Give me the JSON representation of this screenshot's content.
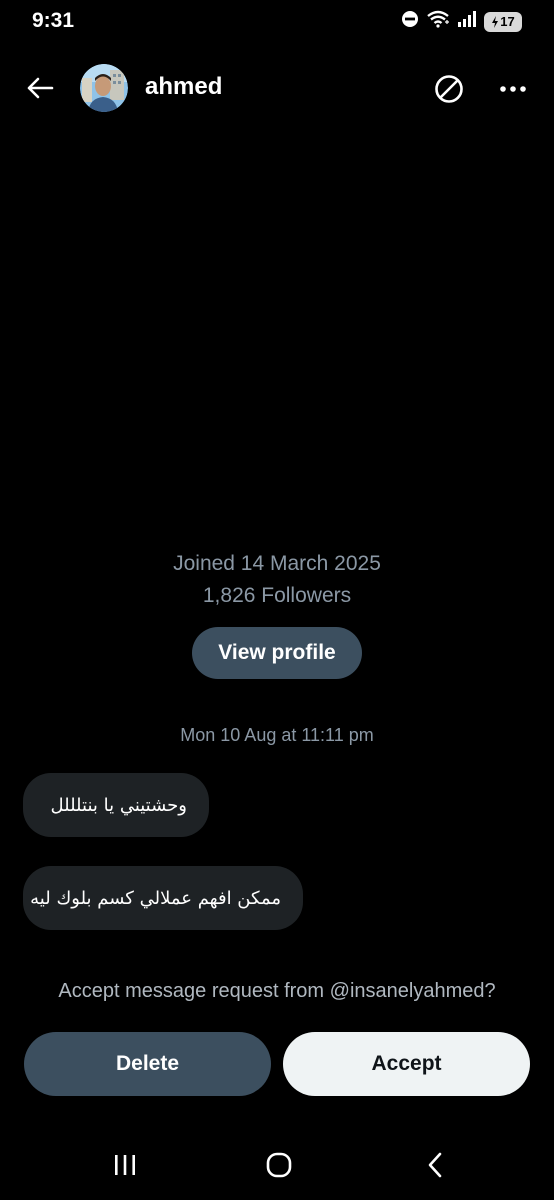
{
  "status_bar": {
    "time": "9:31",
    "battery": "17",
    "icons": [
      "do-not-disturb-icon",
      "wifi-icon",
      "signal-icon",
      "battery-icon"
    ]
  },
  "header": {
    "name": "ahmed",
    "icons": [
      "back-arrow-icon",
      "block-icon",
      "more-icon"
    ]
  },
  "profile": {
    "joined": "Joined 14 March 2025",
    "followers": "1,826 Followers",
    "view_profile_label": "View profile"
  },
  "conversation": {
    "timestamp": "Mon 10 Aug at 11:11 pm",
    "messages": [
      "وحشتيني يا بنتلللل",
      "ممكن افهم عملالي كسم بلوك ليه"
    ]
  },
  "request": {
    "prompt": "Accept message request from @insanelyahmed?",
    "delete_label": "Delete",
    "accept_label": "Accept"
  },
  "nav_bar": {
    "icons": [
      "recents-icon",
      "home-icon",
      "back-icon"
    ]
  },
  "colors": {
    "background": "#000000",
    "secondary_text": "#8b98a5",
    "bubble": "#1e2225",
    "dark_button": "#3c4f5f",
    "light_button": "#eff3f4"
  }
}
